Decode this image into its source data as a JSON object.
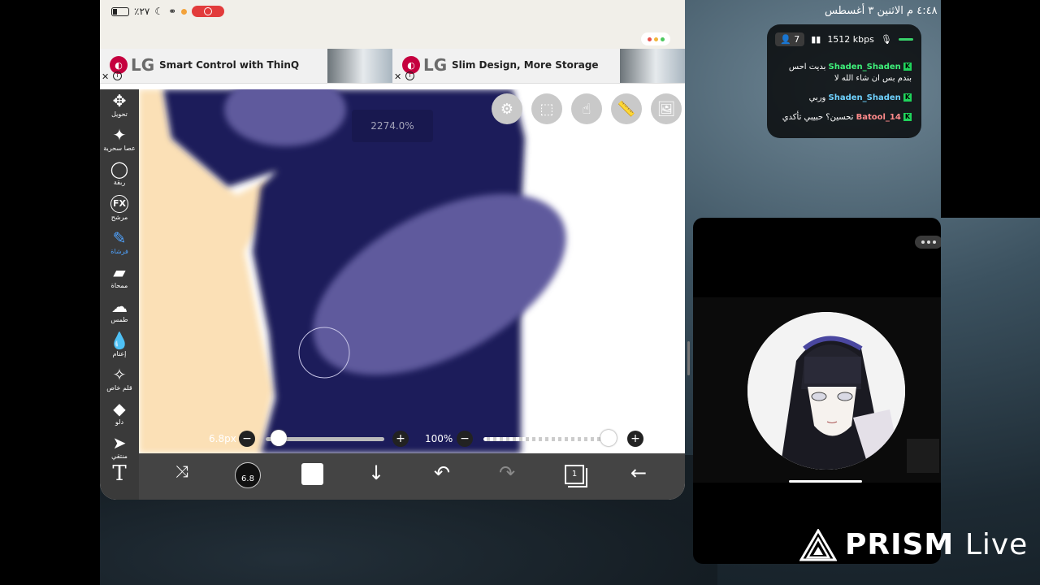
{
  "system_status": {
    "time_date": "٤:٤٨ م   الاثنين ٣ أغسطس"
  },
  "app_status": {
    "battery": "٪٢٧"
  },
  "ads": [
    {
      "logo": "LG",
      "title": "Smart Control with ThinQ"
    },
    {
      "logo": "LG",
      "title": "Slim Design, More Storage"
    }
  ],
  "tools": [
    {
      "label": "تحويل",
      "icon": "✥",
      "active": false
    },
    {
      "label": "عصا سحرية",
      "icon": "✦",
      "active": false
    },
    {
      "label": "ربقة",
      "icon": "◯",
      "active": false
    },
    {
      "label": "مرشح",
      "icon": "FX",
      "active": false
    },
    {
      "label": "فرشاة",
      "icon": "✎",
      "active": true
    },
    {
      "label": "ممحاة",
      "icon": "▰",
      "active": false
    },
    {
      "label": "طمس",
      "icon": "☁",
      "active": false
    },
    {
      "label": "إعتام",
      "icon": "💧",
      "active": false
    },
    {
      "label": "قلم خاص",
      "icon": "✧",
      "active": false
    },
    {
      "label": "دلو",
      "icon": "◆",
      "active": false
    },
    {
      "label": "منتقي",
      "icon": "➤",
      "active": false
    },
    {
      "label": "",
      "icon": "T",
      "active": false
    }
  ],
  "canvas": {
    "zoom_label": "2274.0%"
  },
  "brush": {
    "size_label": "6.8px",
    "size_fraction": 0.05,
    "opacity_label": "100%",
    "opacity_fraction": 1.0,
    "circle_value": "6.8"
  },
  "layers": {
    "count": "1"
  },
  "chat": {
    "viewers": "7",
    "bitrate": "1512 kbps",
    "messages": [
      {
        "user": "Shaden_Shaden",
        "text": "بديت احس بندم بس ان شاء الله لا",
        "user_color": "#3ff07a"
      },
      {
        "user": "Shaden_Shaden",
        "text": "وربي",
        "user_color": "#6fd2ff"
      },
      {
        "user": "Batool_14",
        "text": "تحسين؟ حبيبي تأكدي",
        "user_color": "#ff8a8a"
      }
    ]
  },
  "watermark": {
    "brand": "PRISM",
    "suffix": "Live"
  },
  "colors": {
    "canvas_navy": "#1e1d5a",
    "canvas_lavender": "#5f5a9d",
    "canvas_skin": "#fbe0b6",
    "toolbar": "#3a3a3a",
    "active_tool": "#4fa3ff"
  }
}
